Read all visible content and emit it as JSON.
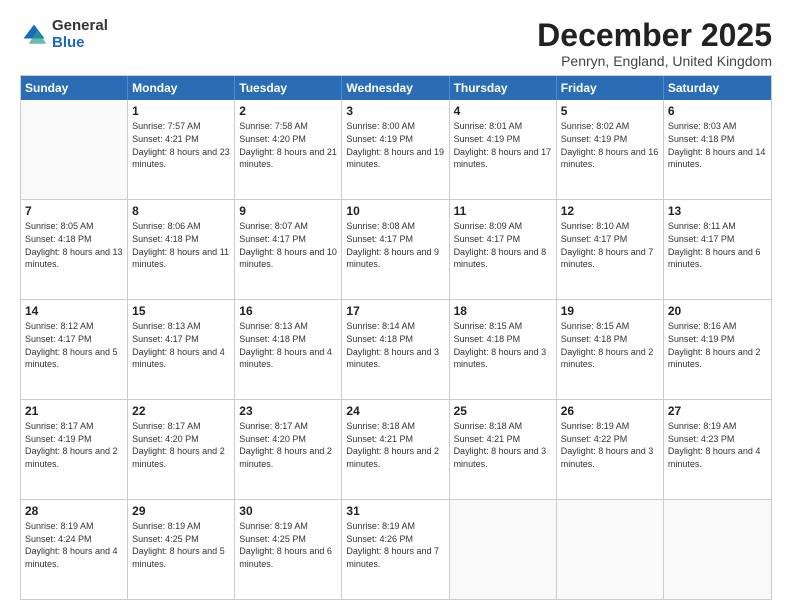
{
  "header": {
    "logo_line1": "General",
    "logo_line2": "Blue",
    "title": "December 2025",
    "subtitle": "Penryn, England, United Kingdom"
  },
  "days": [
    "Sunday",
    "Monday",
    "Tuesday",
    "Wednesday",
    "Thursday",
    "Friday",
    "Saturday"
  ],
  "weeks": [
    [
      {
        "day": "",
        "sunrise": "",
        "sunset": "",
        "daylight": ""
      },
      {
        "day": "1",
        "sunrise": "7:57 AM",
        "sunset": "4:21 PM",
        "daylight": "8 hours and 23 minutes."
      },
      {
        "day": "2",
        "sunrise": "7:58 AM",
        "sunset": "4:20 PM",
        "daylight": "8 hours and 21 minutes."
      },
      {
        "day": "3",
        "sunrise": "8:00 AM",
        "sunset": "4:19 PM",
        "daylight": "8 hours and 19 minutes."
      },
      {
        "day": "4",
        "sunrise": "8:01 AM",
        "sunset": "4:19 PM",
        "daylight": "8 hours and 17 minutes."
      },
      {
        "day": "5",
        "sunrise": "8:02 AM",
        "sunset": "4:19 PM",
        "daylight": "8 hours and 16 minutes."
      },
      {
        "day": "6",
        "sunrise": "8:03 AM",
        "sunset": "4:18 PM",
        "daylight": "8 hours and 14 minutes."
      }
    ],
    [
      {
        "day": "7",
        "sunrise": "8:05 AM",
        "sunset": "4:18 PM",
        "daylight": "8 hours and 13 minutes."
      },
      {
        "day": "8",
        "sunrise": "8:06 AM",
        "sunset": "4:18 PM",
        "daylight": "8 hours and 11 minutes."
      },
      {
        "day": "9",
        "sunrise": "8:07 AM",
        "sunset": "4:17 PM",
        "daylight": "8 hours and 10 minutes."
      },
      {
        "day": "10",
        "sunrise": "8:08 AM",
        "sunset": "4:17 PM",
        "daylight": "8 hours and 9 minutes."
      },
      {
        "day": "11",
        "sunrise": "8:09 AM",
        "sunset": "4:17 PM",
        "daylight": "8 hours and 8 minutes."
      },
      {
        "day": "12",
        "sunrise": "8:10 AM",
        "sunset": "4:17 PM",
        "daylight": "8 hours and 7 minutes."
      },
      {
        "day": "13",
        "sunrise": "8:11 AM",
        "sunset": "4:17 PM",
        "daylight": "8 hours and 6 minutes."
      }
    ],
    [
      {
        "day": "14",
        "sunrise": "8:12 AM",
        "sunset": "4:17 PM",
        "daylight": "8 hours and 5 minutes."
      },
      {
        "day": "15",
        "sunrise": "8:13 AM",
        "sunset": "4:17 PM",
        "daylight": "8 hours and 4 minutes."
      },
      {
        "day": "16",
        "sunrise": "8:13 AM",
        "sunset": "4:18 PM",
        "daylight": "8 hours and 4 minutes."
      },
      {
        "day": "17",
        "sunrise": "8:14 AM",
        "sunset": "4:18 PM",
        "daylight": "8 hours and 3 minutes."
      },
      {
        "day": "18",
        "sunrise": "8:15 AM",
        "sunset": "4:18 PM",
        "daylight": "8 hours and 3 minutes."
      },
      {
        "day": "19",
        "sunrise": "8:15 AM",
        "sunset": "4:18 PM",
        "daylight": "8 hours and 2 minutes."
      },
      {
        "day": "20",
        "sunrise": "8:16 AM",
        "sunset": "4:19 PM",
        "daylight": "8 hours and 2 minutes."
      }
    ],
    [
      {
        "day": "21",
        "sunrise": "8:17 AM",
        "sunset": "4:19 PM",
        "daylight": "8 hours and 2 minutes."
      },
      {
        "day": "22",
        "sunrise": "8:17 AM",
        "sunset": "4:20 PM",
        "daylight": "8 hours and 2 minutes."
      },
      {
        "day": "23",
        "sunrise": "8:17 AM",
        "sunset": "4:20 PM",
        "daylight": "8 hours and 2 minutes."
      },
      {
        "day": "24",
        "sunrise": "8:18 AM",
        "sunset": "4:21 PM",
        "daylight": "8 hours and 2 minutes."
      },
      {
        "day": "25",
        "sunrise": "8:18 AM",
        "sunset": "4:21 PM",
        "daylight": "8 hours and 3 minutes."
      },
      {
        "day": "26",
        "sunrise": "8:19 AM",
        "sunset": "4:22 PM",
        "daylight": "8 hours and 3 minutes."
      },
      {
        "day": "27",
        "sunrise": "8:19 AM",
        "sunset": "4:23 PM",
        "daylight": "8 hours and 4 minutes."
      }
    ],
    [
      {
        "day": "28",
        "sunrise": "8:19 AM",
        "sunset": "4:24 PM",
        "daylight": "8 hours and 4 minutes."
      },
      {
        "day": "29",
        "sunrise": "8:19 AM",
        "sunset": "4:25 PM",
        "daylight": "8 hours and 5 minutes."
      },
      {
        "day": "30",
        "sunrise": "8:19 AM",
        "sunset": "4:25 PM",
        "daylight": "8 hours and 6 minutes."
      },
      {
        "day": "31",
        "sunrise": "8:19 AM",
        "sunset": "4:26 PM",
        "daylight": "8 hours and 7 minutes."
      },
      {
        "day": "",
        "sunrise": "",
        "sunset": "",
        "daylight": ""
      },
      {
        "day": "",
        "sunrise": "",
        "sunset": "",
        "daylight": ""
      },
      {
        "day": "",
        "sunrise": "",
        "sunset": "",
        "daylight": ""
      }
    ]
  ],
  "labels": {
    "sunrise": "Sunrise:",
    "sunset": "Sunset:",
    "daylight": "Daylight:"
  }
}
